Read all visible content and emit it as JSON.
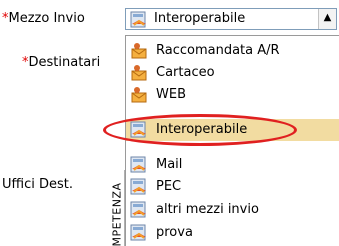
{
  "form": {
    "mezzo_invio_label": "Mezzo Invio",
    "required_mark": "*",
    "destinatari_label": "Destinatari",
    "uffici_dest_label": "Uffici Dest.",
    "section_vertical_label": "MPETENZA"
  },
  "select": {
    "selected_value": "Interoperabile",
    "selected_icon": "interop-doc-icon",
    "dropdown_arrow_icon": "up-arrow-icon"
  },
  "options": [
    {
      "label": "Raccomandata A/R",
      "icon": "envelope-person-icon"
    },
    {
      "label": "Cartaceo",
      "icon": "envelope-person-icon"
    },
    {
      "label": "WEB",
      "icon": "envelope-person-icon"
    },
    {
      "label": "Interoperabile",
      "icon": "interop-doc-icon",
      "highlighted": true
    },
    {
      "label": "Mail",
      "icon": "interop-doc-icon"
    },
    {
      "label": "PEC",
      "icon": "interop-doc-icon"
    },
    {
      "label": "altri mezzi invio",
      "icon": "interop-doc-icon"
    },
    {
      "label": "prova",
      "icon": "interop-doc-icon"
    }
  ],
  "colors": {
    "required_star": "#e00000",
    "highlight_bg": "#f2dca1",
    "annotation_ellipse": "#e02020",
    "select_border": "#7f9db9"
  }
}
